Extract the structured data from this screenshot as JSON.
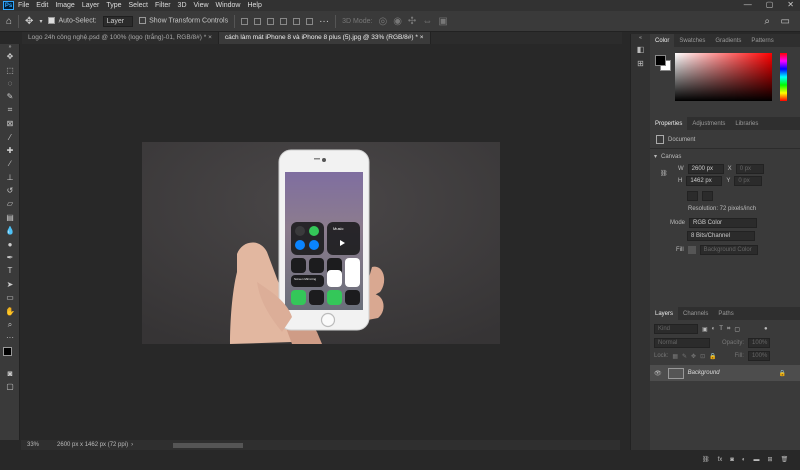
{
  "app": {
    "logo": "Ps"
  },
  "menu": [
    "File",
    "Edit",
    "Image",
    "Layer",
    "Type",
    "Select",
    "Filter",
    "3D",
    "View",
    "Window",
    "Help"
  ],
  "window_controls": {
    "minimize": "—",
    "restore": "▢",
    "close": "✕"
  },
  "options": {
    "auto_select_label": "Auto-Select:",
    "auto_select_value": "Layer",
    "transform_label": "Show Transform Controls",
    "mode_3d": "3D Mode:"
  },
  "tabs": [
    {
      "label": "Logo 24h công nghệ.psd @ 100% (logo (trắng)-01, RGB/8#) *",
      "active": false
    },
    {
      "label": "cách làm mát iPhone 8 và iPhone 8 plus (5).jpg @ 33% (RGB/8#) *",
      "active": true
    }
  ],
  "status": {
    "zoom": "33%",
    "doc_info": "2600 px x 1462 px (72 ppi)"
  },
  "color_panel": {
    "tabs": [
      "Color",
      "Swatches",
      "Gradients",
      "Patterns"
    ],
    "fg_color": "#000000",
    "bg_color": "#ffffff",
    "hue_color": "#ff0000"
  },
  "properties": {
    "tabs": [
      "Properties",
      "Adjustments",
      "Libraries"
    ],
    "doc_label": "Document",
    "canvas_label": "Canvas",
    "w_label": "W",
    "w_value": "2600 px",
    "h_label": "H",
    "h_value": "1462 px",
    "x_label": "X",
    "x_value": "0 px",
    "y_label": "Y",
    "y_value": "0 px",
    "resolution": "Resolution: 72 pixels/inch",
    "mode_label": "Mode",
    "mode_value": "RGB Color",
    "bits_value": "8 Bits/Channel",
    "fill_label": "Fill",
    "fill_value": "Background Color"
  },
  "layers": {
    "tabs": [
      "Layers",
      "Channels",
      "Paths"
    ],
    "kind": "Kind",
    "blend": "Normal",
    "opacity_label": "Opacity:",
    "opacity_value": "100%",
    "lock_label": "Lock:",
    "fill_label": "Fill:",
    "fill_value": "100%",
    "layer_name": "Background"
  },
  "phone_cc": {
    "music_label": "Music",
    "mirroring": "Screen Mirroring"
  }
}
